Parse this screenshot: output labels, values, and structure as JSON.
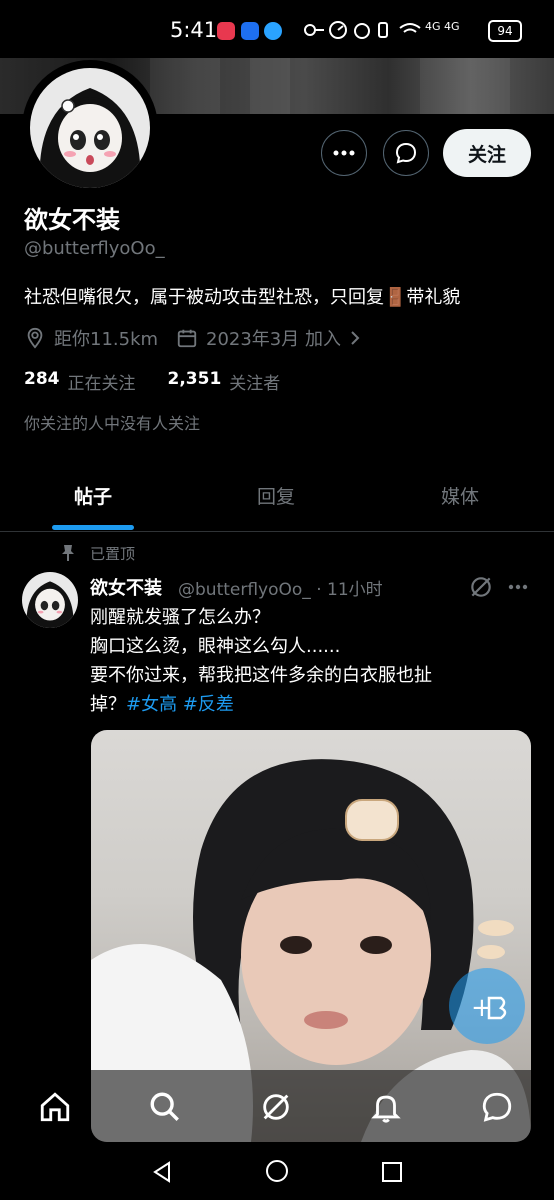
{
  "status_bar": {
    "time": "5:41",
    "signal_text": "4G 4G",
    "battery": "94"
  },
  "profile": {
    "display_name": "欲女不装",
    "handle": "@butterflyoOo_",
    "bio_text": "社恐但嘴很欠，属于被动攻击型社恐，只回复",
    "bio_emoji": "🚪",
    "bio_end": "带礼貌",
    "location": "距你11.5km",
    "joined": "2023年3月 加入",
    "following_count": "284",
    "following_label": "正在关注",
    "followers_count": "2,351",
    "followers_label": "关注者",
    "no_mutual": "你关注的人中没有人关注",
    "follow_button": "关注"
  },
  "tabs": [
    {
      "label": "帖子",
      "active": true
    },
    {
      "label": "回复",
      "active": false
    },
    {
      "label": "媒体",
      "active": false
    }
  ],
  "post": {
    "pinned_label": "已置顶",
    "author": "欲女不装",
    "handle_time": "@butterflyoOo_ · 11小时",
    "line1": "刚醒就发骚了怎么办？",
    "line2": "胸口这么烫，眼神这么勾人......",
    "line3": "要不你过来，帮我把这件多余的白衣服也扯",
    "line4_prefix": "掉？",
    "tag1": "#女高",
    "tag2": "#反差"
  },
  "colors": {
    "accent": "#1d9bf0",
    "background": "#000000",
    "muted": "#71767b"
  },
  "icons": [
    "more-icon",
    "message-icon",
    "location-icon",
    "calendar-icon",
    "chevron-right-icon",
    "pin-icon",
    "grok-icon",
    "home-icon",
    "search-icon",
    "notifications-icon",
    "messages-icon",
    "back-icon",
    "home-circle-icon",
    "recents-icon"
  ]
}
